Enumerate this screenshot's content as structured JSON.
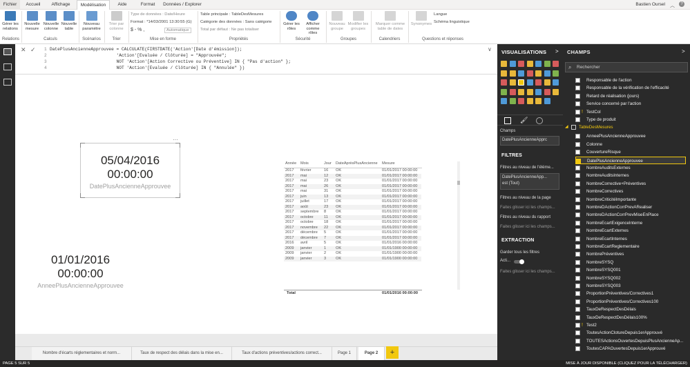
{
  "ribbon_tabs": [
    "Fichier",
    "Accueil",
    "Affichage",
    "Modélisation",
    "Aide",
    "Format",
    "Données / Explorer"
  ],
  "user_name": "Bastien Oursel",
  "ribbon": {
    "buttons": [
      {
        "label": "Gérer les relations"
      },
      {
        "label": "Nouvelle mesure"
      },
      {
        "label": "Nouvelle colonne"
      },
      {
        "label": "Nouvelle table"
      },
      {
        "label": "Nouveau paramètre"
      },
      {
        "label": "Trier par colonne"
      },
      {
        "label": "Gérer les rôles"
      },
      {
        "label": "Afficher comme rôles"
      },
      {
        "label": "Nouveau groupe"
      },
      {
        "label": "Modifier les groupes"
      },
      {
        "label": "Marquer comme table de dates"
      },
      {
        "label": "Synonymes"
      }
    ],
    "groups": [
      "Relations",
      "Calculs",
      "Scénarios",
      "Trier",
      "Mise en forme",
      "Propriétés",
      "Sécurité",
      "Groupes",
      "Calendriers",
      "Questions et réponses"
    ],
    "type_donnees": "Type de données : Date/Heure",
    "format": "Format : *14/03/2001 13:30:55 (G)",
    "format_symbols": "$ - % ,",
    "auto": "Automatique",
    "table_principale": "Table principale : TableDesMesures",
    "categorie": "Catégorie des données : Sans catégorie",
    "total_defaut": "Total par défaut : Ne pas totaliser",
    "langue": "Langue",
    "schema": "Schéma linguistique"
  },
  "formula": {
    "lines": [
      "DatePlusAncienneApprouvee = CALCULATE(FIRSTDATE('Action'[Date d'émission]);",
      "                          'Action'[Evaluée / Clôturée] = \"Approuvée\";",
      "                          NOT 'Action'[Action Corrective ou Préventive] IN { \"Pas d'action\" };",
      "                          NOT 'Action'[Evaluée / Clôturée] IN { \"Annulée\" })"
    ],
    "line_numbers": [
      "1",
      "2",
      "3",
      "4"
    ]
  },
  "cards": [
    {
      "value_line1": "05/04/2016",
      "value_line2": "00:00:00",
      "label": "DatePlusAncienneApprouvee"
    },
    {
      "value_line1": "01/01/2016",
      "value_line2": "00:00:00",
      "label": "AnneePlusAncienneApprouvee"
    }
  ],
  "table": {
    "headers": [
      "Année",
      "Mois",
      "Jour",
      "DateAprèsPlusAncienne",
      "Mesure"
    ],
    "rows": [
      [
        "2017",
        "février",
        "16",
        "OK",
        "01/01/2017 00:00:00"
      ],
      [
        "2017",
        "mai",
        "12",
        "OK",
        "01/01/2017 00:00:00"
      ],
      [
        "2017",
        "mai",
        "23",
        "OK",
        "01/01/2017 00:00:00"
      ],
      [
        "2017",
        "mai",
        "26",
        "OK",
        "01/01/2017 00:00:00"
      ],
      [
        "2017",
        "mai",
        "31",
        "OK",
        "01/01/2017 00:00:00"
      ],
      [
        "2017",
        "juin",
        "13",
        "OK",
        "01/01/2017 00:00:00"
      ],
      [
        "2017",
        "juillet",
        "17",
        "OK",
        "01/01/2017 00:00:00"
      ],
      [
        "2017",
        "août",
        "23",
        "OK",
        "01/01/2017 00:00:00"
      ],
      [
        "2017",
        "septembre",
        "8",
        "OK",
        "01/01/2017 00:00:00"
      ],
      [
        "2017",
        "octobre",
        "11",
        "OK",
        "01/01/2017 00:00:00"
      ],
      [
        "2017",
        "octobre",
        "18",
        "OK",
        "01/01/2017 00:00:00"
      ],
      [
        "2017",
        "novembre",
        "22",
        "OK",
        "01/01/2017 00:00:00"
      ],
      [
        "2017",
        "décembre",
        "5",
        "OK",
        "01/01/2017 00:00:00"
      ],
      [
        "2017",
        "décembre",
        "7",
        "OK",
        "01/01/2017 00:00:00"
      ],
      [
        "2016",
        "avril",
        "5",
        "OK",
        "01/01/2016 00:00:00"
      ],
      [
        "2009",
        "janvier",
        "1",
        "OK",
        "01/01/1900 00:00:00"
      ],
      [
        "2009",
        "janvier",
        "2",
        "OK",
        "01/01/1900 00:00:00"
      ],
      [
        "2009",
        "janvier",
        "3",
        "OK",
        "01/01/1900 00:00:00"
      ]
    ],
    "total_label": "Total",
    "total_value": "01/01/2016 00:00:00"
  },
  "page_tabs": [
    "Nombre d'écarts réglementaires et norm...",
    "Taux de respect des délais dans la mise en...",
    "Taux d'actions préventives/actions correct...",
    "Page 1",
    "Page 2"
  ],
  "add_page": "+",
  "status_left": "PAGE 5 SUR 5",
  "status_right": "MISE À JOUR DISPONIBLE (CLIQUEZ POUR LA TÉLÉCHARGER)",
  "visualisations": {
    "title": "VISUALISATIONS",
    "champs_label": "Champs",
    "champs_value": "DatePlusAncienneApprc",
    "filtres_title": "FILTRES",
    "filtre_visuel": "Filtres au niveau de l'éléme...",
    "filtre_field": "DatePlusAncienneApp...",
    "filtre_value": "est (Tout)",
    "filtre_page": "Filtres au niveau de la page",
    "drag_here": "Faites glisser ici les champs...",
    "filtre_rapport": "Filtres au niveau du rapport",
    "drag_here2": "Faites glisser ici les champs...",
    "extraction_title": "EXTRACTION",
    "garder": "Garder tous les filtres",
    "toggle": "Acti...",
    "drag_here3": "Faites glisser ici les champs..."
  },
  "champs": {
    "title": "CHAMPS",
    "search_placeholder": "Rechercher",
    "fields_top": [
      "Responsable de l'action",
      "Responsable de la vérification de l'efficacité",
      "Retard de réalisation (jours)",
      "Service concerné par l'action",
      "TestCol",
      "Type de produit"
    ],
    "table_name": "TableDesMesures",
    "measures": [
      "AnneePlusAncienneApprouvee",
      "Colonne",
      "CouvertureRisque",
      "DatePlusAncienneApprouvee",
      "NombreAuditsExternes",
      "NombreAuditsInternes",
      "NombreCorrective+Préventives",
      "NombreCorrectives",
      "NombreCriticitéImportante",
      "NombreDActionCorrPrevARealiser",
      "NombreDActionCorrPrevMiseEnPlace",
      "NombreEcartExigenceInterne",
      "NombreEcartExternes",
      "NombreEcartInternes",
      "NombreEcartReglementaire",
      "NombrePréventives",
      "NombreSYSQ",
      "NombreSYSQ001",
      "NombreSYSQ002",
      "NombreSYSQ003",
      "ProportionPréventives/Correctives1",
      "ProportionPréventives/Correctives100",
      "TauxDeRespectDesDélais",
      "TauxDeRespectDesDélais100%",
      "Test2",
      "ToutesActionClotureDepuis1erApprouvé",
      "TOUTESActionsOuvertesDepuisPlusAncienneAp...",
      "ToutesCAPAOuvertesDepuis1erApprouvé"
    ]
  },
  "colors": {
    "accent": "#f2c80f",
    "dark_pane": "#2a2a2a",
    "ribbon_active": "#ffffff"
  }
}
